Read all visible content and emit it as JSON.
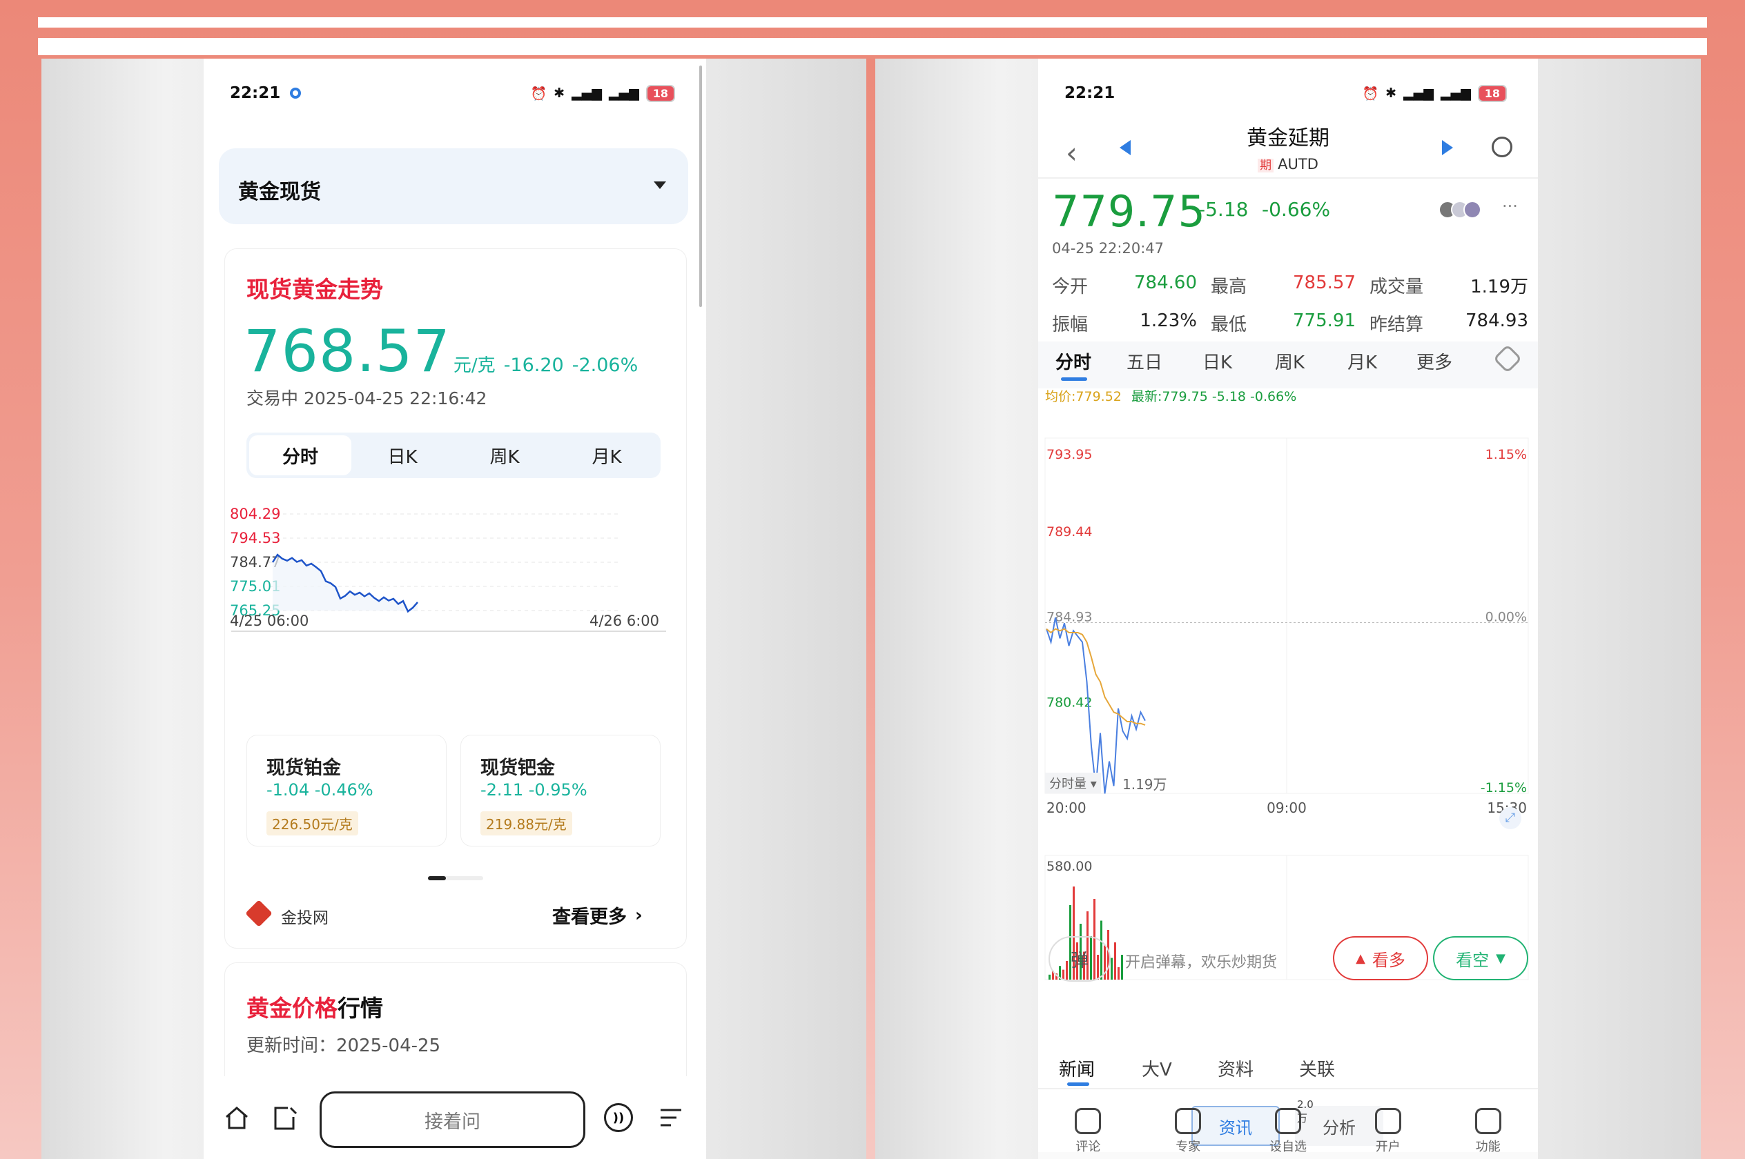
{
  "left": {
    "status": {
      "time": "22:21",
      "battery": "18",
      "signal": "5G"
    },
    "selector": {
      "label": "黄金现货"
    },
    "card": {
      "title": "现货黄金走势",
      "price": "768.57",
      "unit": "元/克",
      "change": "-16.20",
      "change_pct": "-2.06%",
      "status": "交易中 2025-04-25 22:16:42",
      "tabs": [
        "分时",
        "日K",
        "周K",
        "月K"
      ],
      "chart_x_start": "4/25 06:00",
      "chart_x_end": "4/26 6:00"
    },
    "mini_cards": [
      {
        "name": "现货铂金",
        "change": "-1.04 -0.46%",
        "price": "226.50元/克"
      },
      {
        "name": "现货钯金",
        "change": "-2.11 -0.95%",
        "price": "219.88元/克"
      }
    ],
    "source": "金投网",
    "more": "查看更多",
    "section2": {
      "title_red": "黄金价格",
      "title_black": "行情",
      "updated": "更新时间：2025-04-25"
    },
    "bottom": {
      "ask": "接着问"
    }
  },
  "right": {
    "status": {
      "time": "22:21",
      "battery": "18",
      "signal": "5G"
    },
    "header": {
      "title": "黄金延期",
      "badge": "期",
      "code": "AUTD"
    },
    "price": "779.75",
    "change": "-5.18",
    "change_pct": "-0.66%",
    "datetime": "04-25 22:20:47",
    "stats": [
      {
        "label": "今开",
        "value": "784.60",
        "color": "#1a9d3e"
      },
      {
        "label": "最高",
        "value": "785.57",
        "color": "#e23b3b"
      },
      {
        "label": "成交量",
        "value": "1.19万",
        "color": "#222"
      },
      {
        "label": "振幅",
        "value": "1.23%",
        "color": "#222"
      },
      {
        "label": "最低",
        "value": "775.91",
        "color": "#1a9d3e"
      },
      {
        "label": "昨结算",
        "value": "784.93",
        "color": "#222"
      }
    ],
    "tabs": [
      "分时",
      "五日",
      "日K",
      "周K",
      "月K",
      "更多"
    ],
    "legend": {
      "avg": "均价:779.52",
      "latest": "最新:779.75 -5.18 -0.66%"
    },
    "volume": {
      "selector": "分时量",
      "total": "1.19万",
      "max": "580.00"
    },
    "danmu": {
      "label": "弹",
      "hint": "开启弹幕，欢乐炒期货"
    },
    "buy": "看多",
    "sell": "看空",
    "news_tabs": [
      "新闻",
      "大V",
      "资料",
      "关联"
    ],
    "sub_tabs": [
      "资讯",
      "分析"
    ],
    "bottom_nav": [
      {
        "label": "评论",
        "icon": "comment-icon"
      },
      {
        "label": "专家",
        "icon": "expert-icon"
      },
      {
        "label": "设自选",
        "icon": "watchlist-icon",
        "badge": "2.0万"
      },
      {
        "label": "开户",
        "icon": "open-account-icon"
      },
      {
        "label": "功能",
        "icon": "menu-icon"
      }
    ]
  },
  "chart_data": [
    {
      "type": "line",
      "title": "现货黄金走势",
      "x": [
        "4/25 06:00",
        "4/26 6:00"
      ],
      "y_ticks": [
        804.29,
        794.53,
        784.77,
        775.01,
        765.25
      ],
      "ylim": [
        765.25,
        804.29
      ],
      "series": [
        {
          "values": [
            784.77,
            787.8,
            786.2,
            785.4,
            786.5,
            784.9,
            785.6,
            783.4,
            784.2,
            782.8,
            781.2,
            777.1,
            776.3,
            774.8,
            770.1,
            771.2,
            773.0,
            771.6,
            772.5,
            771.0,
            772.2,
            770.4,
            769.1,
            770.6,
            769.3,
            770.0,
            767.9,
            769.1,
            764.9,
            766.4,
            768.6
          ]
        }
      ]
    },
    {
      "type": "line",
      "title": "黄金延期",
      "x": [
        "20:00",
        "09:00",
        "15:30"
      ],
      "y_ticks": [
        793.95,
        789.44,
        784.93,
        780.42,
        775.91
      ],
      "right_ticks": [
        "1.15%",
        "0.00%",
        "-1.15%"
      ],
      "ylim": [
        775.91,
        793.95
      ],
      "series": [
        {
          "name": "最新",
          "values": [
            784.6,
            783.9,
            785.2,
            784.1,
            784.9,
            783.7,
            784.5,
            784.2,
            783.9,
            781.8,
            778.4,
            776.2,
            779.1,
            775.9,
            777.6,
            776.3,
            780.4,
            779.2,
            778.8,
            780.0,
            779.3,
            780.2,
            779.75
          ]
        },
        {
          "name": "均价",
          "values": [
            784.6,
            784.4,
            784.6,
            784.5,
            784.6,
            784.4,
            784.4,
            784.4,
            784.3,
            783.9,
            783.1,
            782.2,
            781.8,
            781.0,
            780.6,
            780.2,
            780.1,
            779.9,
            779.7,
            779.7,
            779.6,
            779.6,
            779.52
          ]
        }
      ]
    }
  ]
}
